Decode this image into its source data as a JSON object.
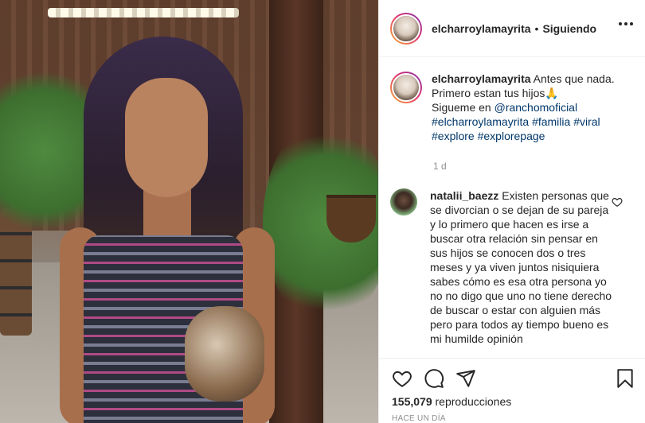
{
  "header": {
    "username": "elcharroylamayrita",
    "separator": "•",
    "follow_status": "Siguiendo"
  },
  "caption": {
    "username": "elcharroylamayrita",
    "line1": "Antes que nada. Primero estan tus hijos",
    "emoji": "🙏",
    "line2_prefix": "Sigueme en ",
    "mention": "@ranchomoficial",
    "hashtags": [
      "#elcharroylamayrita",
      "#familia",
      "#viral",
      "#explore",
      "#explorepage"
    ],
    "age": "1 d"
  },
  "comment": {
    "username": "natalii_baezz",
    "text": "Existen personas que se divorcian o se dejan de su pareja y lo primero que hacen es irse a buscar otra relación sin pensar en sus hijos se conocen dos o tres meses y ya viven juntos nisiquiera sabes cómo es esa otra persona yo no no digo que uno no tiene derecho de buscar o estar con alguien más pero para todos ay tiempo bueno es mi humilde opinión"
  },
  "actions": {
    "icons": [
      "heart-icon",
      "comment-icon",
      "share-icon",
      "bookmark-icon"
    ],
    "views_count": "155,079",
    "views_label": "reproducciones",
    "posted": "HACE UN DÍA"
  },
  "colors": {
    "text": "#262626",
    "link": "#00376b",
    "muted": "#8e8e8e",
    "border": "#efefef"
  }
}
